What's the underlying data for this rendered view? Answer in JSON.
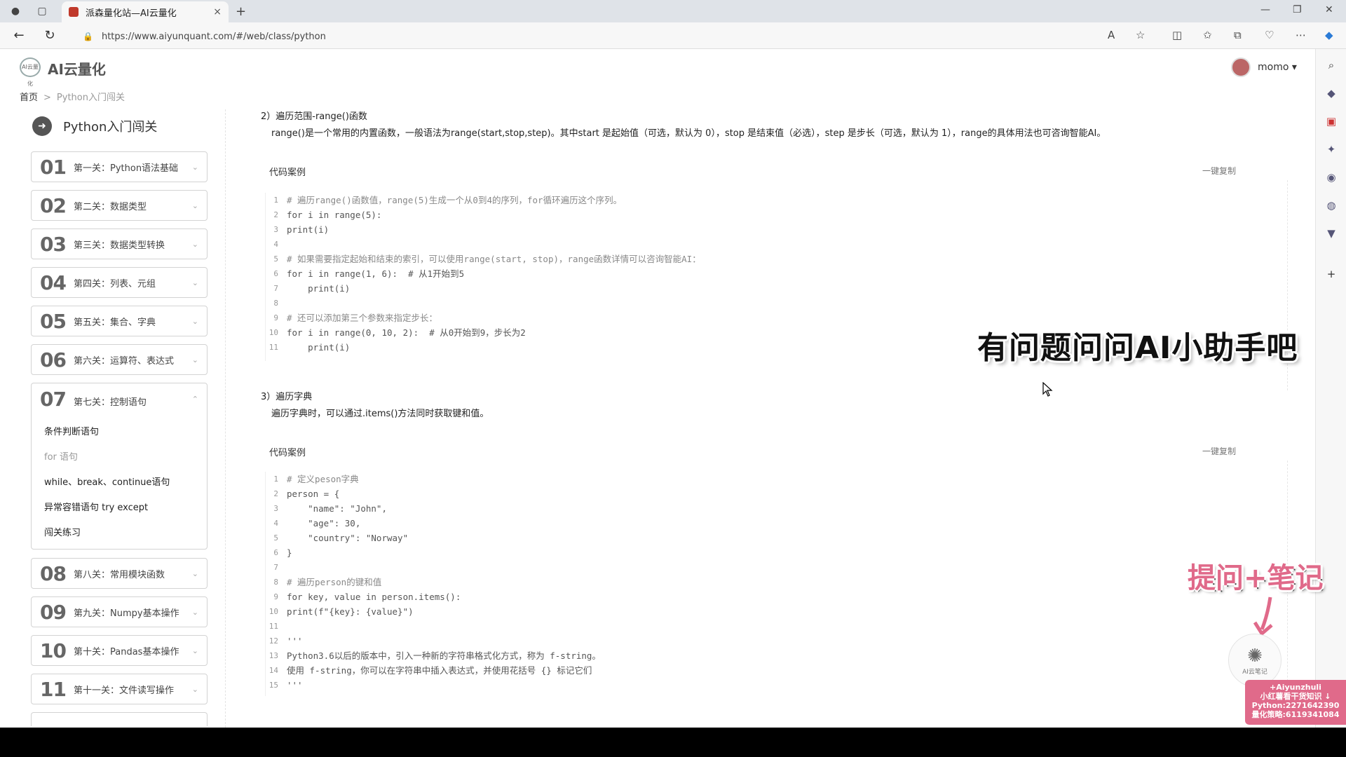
{
  "browser": {
    "tab_title": "派森量化站—AI云量化",
    "url": "https://www.aiyunquant.com/#/web/class/python",
    "new_tab": "+",
    "close_tab": "×"
  },
  "header": {
    "logo_text": "AI云量化",
    "logo_mark": "AI云量化",
    "username": "momo ▾"
  },
  "breadcrumb": {
    "home": "首页",
    "separator": ">",
    "current": "Python入门闯关"
  },
  "sidebar": {
    "course_title": "Python入门闯关",
    "chapters": [
      {
        "num": "01",
        "label": "第一关：Python语法基础"
      },
      {
        "num": "02",
        "label": "第二关：数据类型"
      },
      {
        "num": "03",
        "label": "第三关：数据类型转换"
      },
      {
        "num": "04",
        "label": "第四关：列表、元组"
      },
      {
        "num": "05",
        "label": "第五关：集合、字典"
      },
      {
        "num": "06",
        "label": "第六关：运算符、表达式"
      },
      {
        "num": "07",
        "label": "第七关：控制语句"
      },
      {
        "num": "08",
        "label": "第八关：常用模块函数"
      },
      {
        "num": "09",
        "label": "第九关：Numpy基本操作"
      },
      {
        "num": "10",
        "label": "第十关：Pandas基本操作"
      },
      {
        "num": "11",
        "label": "第十一关：文件读写操作"
      }
    ],
    "open_chapter_items": [
      "条件判断语句",
      "for 语句",
      "while、break、continue语句",
      "异常容错语句 try except",
      "闯关练习"
    ]
  },
  "main": {
    "section2": {
      "title": "2）遍历范围-range()函数",
      "desc": "range()是一个常用的内置函数，一般语法为range(start,stop,step)。其中start 是起始值（可选，默认为 0），stop 是结束值（必选），step 是步长（可选，默认为 1），range的具体用法也可咨询智能AI。",
      "code_label": "代码案例",
      "copy_label": "一键复制",
      "code": [
        "# 遍历range()函数值，range(5)生成一个从0到4的序列，for循环遍历这个序列。",
        "for i in range(5):",
        "print(i)",
        "",
        "# 如果需要指定起始和结束的索引，可以使用range(start, stop)，range函数详情可以咨询智能AI：",
        "for i in range(1, 6):  # 从1开始到5",
        "    print(i)",
        "",
        "# 还可以添加第三个参数来指定步长：",
        "for i in range(0, 10, 2):  # 从0开始到9，步长为2",
        "    print(i)"
      ]
    },
    "section3": {
      "title": "3）遍历字典",
      "desc": "遍历字典时，可以通过.items()方法同时获取键和值。",
      "code_label": "代码案例",
      "copy_label": "一键复制",
      "code": [
        "# 定义peson字典",
        "person = {",
        "    \"name\": \"John\",",
        "    \"age\": 30,",
        "    \"country\": \"Norway\"",
        "}",
        "",
        "# 遍历person的键和值",
        "for key, value in person.items():",
        "print(f\"{key}: {value}\")",
        "",
        "'''",
        "Python3.6以后的版本中，引入一种新的字符串格式化方式，称为 f-string。",
        "使用 f-string，你可以在字符串中插入表达式，并使用花括号 {} 标记它们",
        "'''"
      ]
    }
  },
  "overlays": {
    "big_caption": "有问题问问AI小助手吧",
    "pink_caption": "提问+笔记",
    "ai_badge": "AI云笔记",
    "promo_lines": [
      "+Aiyunzhuli",
      "小红薯看干货知识 ↓",
      "Python:2271642390",
      "量化策略:6119341084"
    ]
  }
}
